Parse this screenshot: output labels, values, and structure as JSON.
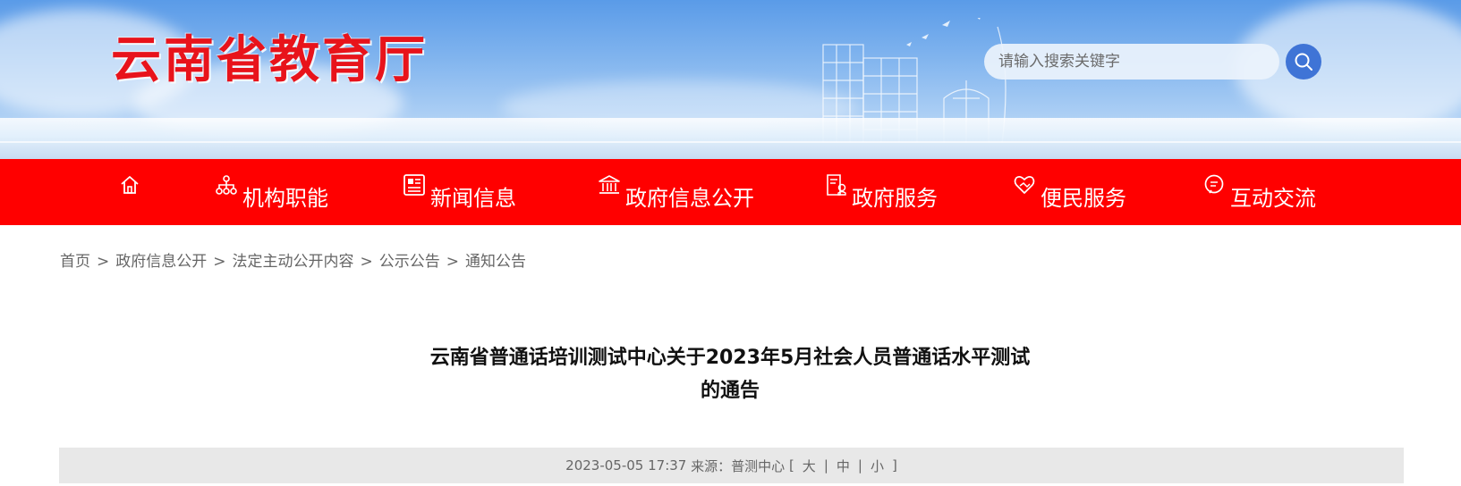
{
  "header": {
    "site_title": "云南省教育厅",
    "search": {
      "placeholder": "请输入搜索关键字",
      "value": ""
    }
  },
  "nav": {
    "items": [
      {
        "label": "",
        "icon": "home-icon"
      },
      {
        "label": "机构职能",
        "icon": "org-structure-icon"
      },
      {
        "label": "新闻信息",
        "icon": "newspaper-icon"
      },
      {
        "label": "政府信息公开",
        "icon": "government-building-icon"
      },
      {
        "label": "政府服务",
        "icon": "service-document-icon"
      },
      {
        "label": "便民服务",
        "icon": "heart-hand-icon"
      },
      {
        "label": "互动交流",
        "icon": "chat-bubble-icon"
      }
    ]
  },
  "breadcrumb": {
    "items": [
      "首页",
      "政府信息公开",
      "法定主动公开内容",
      "公示公告",
      "通知公告"
    ],
    "separator": ">"
  },
  "article": {
    "title_line1": "云南省普通话培训测试中心关于2023年5月社会人员普通话水平测试",
    "title_line2": "的通告",
    "meta": {
      "datetime": "2023-05-05 17:37",
      "source_label": "来源：",
      "source": "普测中心",
      "bracket_open": "[",
      "bracket_close": "]",
      "size_large": "大",
      "size_medium": "中",
      "size_small": "小",
      "pipe": "|"
    }
  },
  "colors": {
    "nav_bg": "#ff0000",
    "title_red": "#e8131b",
    "search_button": "#3f74d6",
    "meta_bg": "#e8e8e8"
  }
}
